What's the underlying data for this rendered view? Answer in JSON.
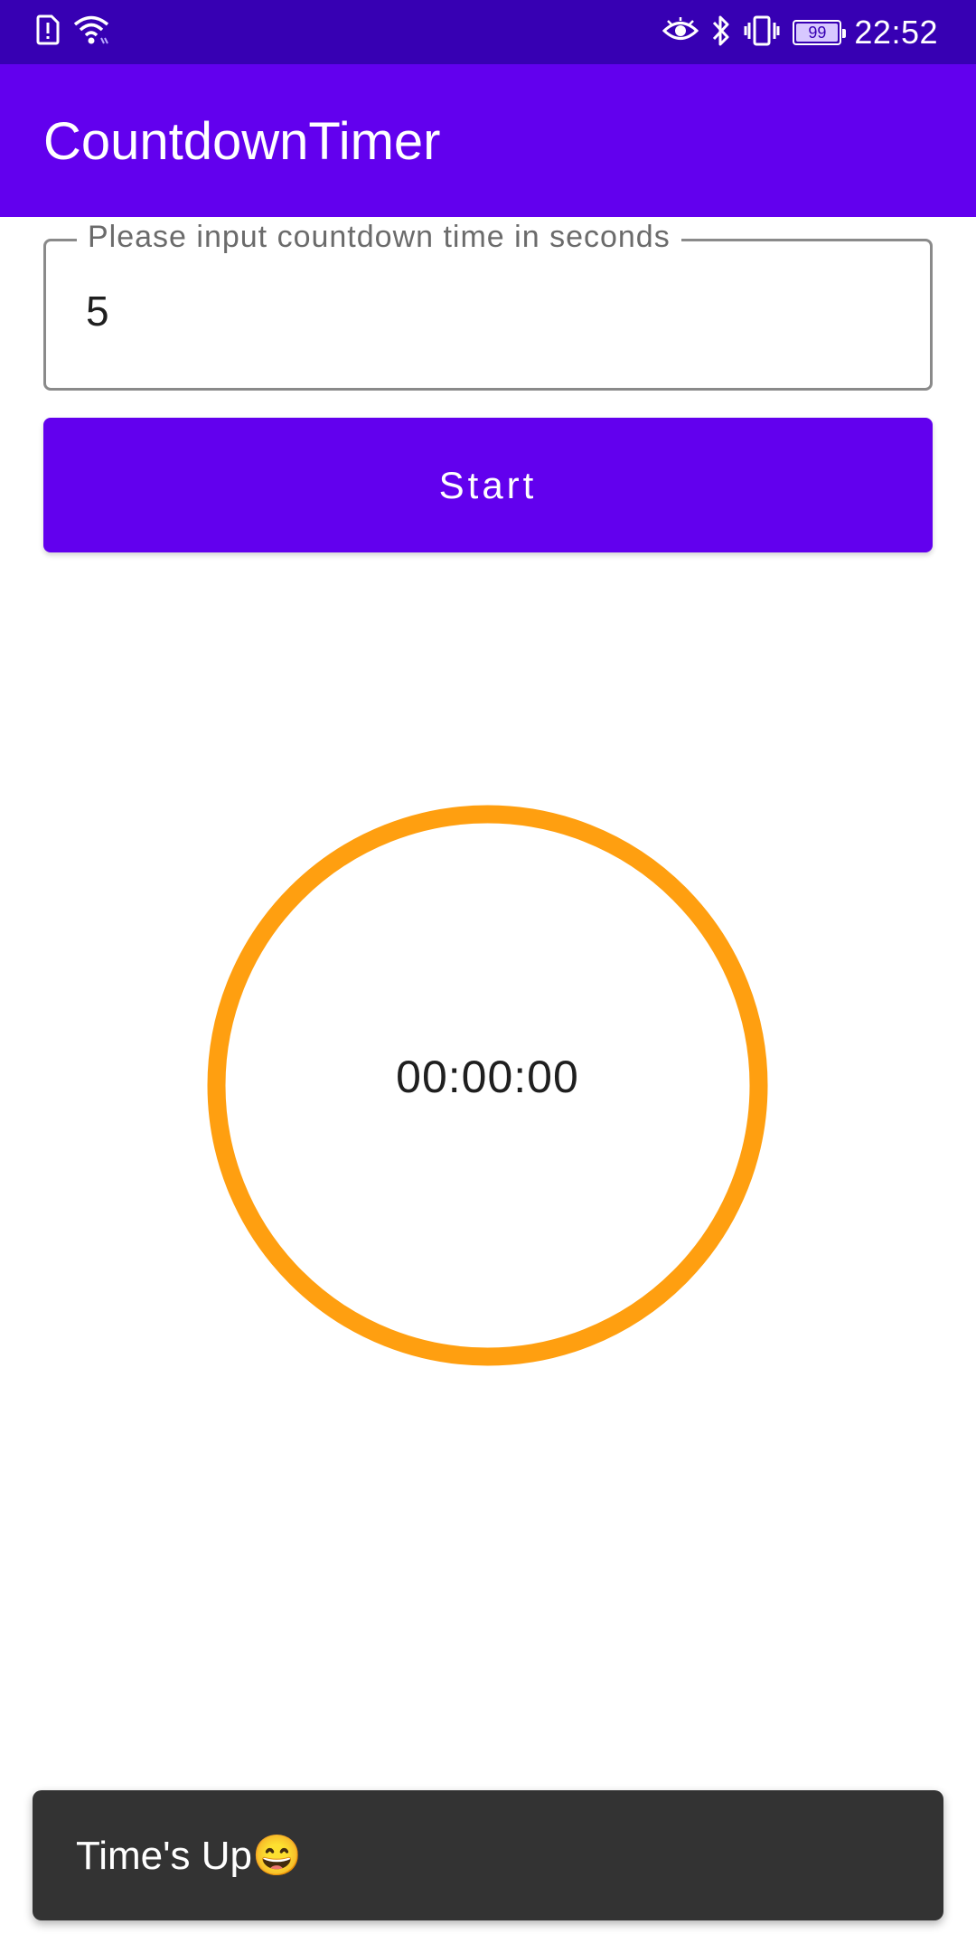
{
  "status_bar": {
    "time": "22:52",
    "battery_level": "99",
    "left_icons": [
      "sim-alert-icon",
      "wifi-icon"
    ],
    "right_icons": [
      "eye-icon",
      "bluetooth-icon",
      "vibrate-icon",
      "battery-icon"
    ]
  },
  "app_bar": {
    "title": "CountdownTimer"
  },
  "input": {
    "label": "Please input countdown time in seconds",
    "value": "5"
  },
  "start_button": {
    "label": "Start"
  },
  "timer": {
    "display": "00:00:00",
    "ring_color": "#ff9f10"
  },
  "snackbar": {
    "message": "Time's Up😄"
  },
  "colors": {
    "primary": "#6200ee",
    "primary_dark": "#3700b3",
    "accent_ring": "#ff9f10",
    "snackbar_bg": "#333333"
  }
}
